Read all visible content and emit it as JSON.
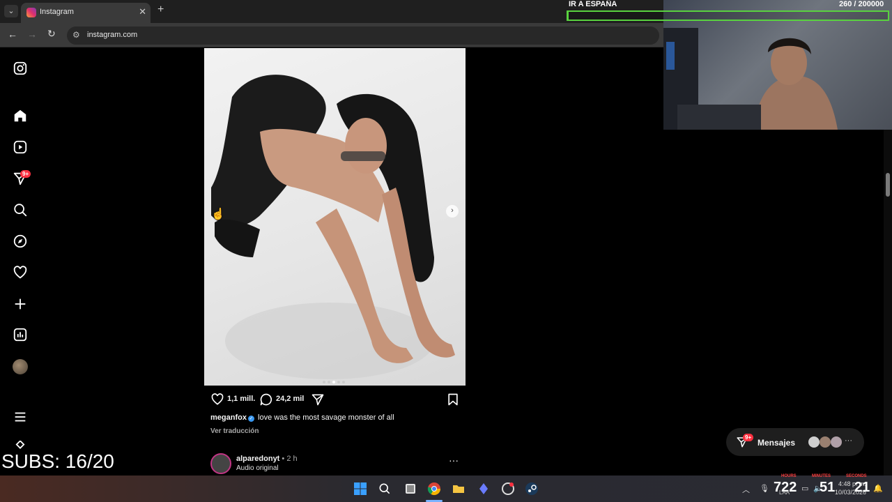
{
  "browser": {
    "tab_title": "Instagram",
    "url": "instagram.com",
    "tab_close": "✕",
    "tab_new": "+"
  },
  "sidebar": {
    "notifications_badge": "9+"
  },
  "post": {
    "likes": "1,1 mill.",
    "comments": "24,2 mil",
    "username": "meganfox",
    "caption": "love was the most savage monster of all",
    "translate": "Ver traducción",
    "carousel_dots": 5,
    "carousel_active": 2
  },
  "next_post": {
    "username": "alparedonyt",
    "time": "• 2 h",
    "subtitle": "Audio original",
    "more": "···"
  },
  "messages": {
    "label": "Mensajes",
    "badge": "9+"
  },
  "stream_overlay": {
    "goal_label": "IR A ESPAÑA",
    "goal_count": "260  / 200000",
    "goal_progress": 0.0013,
    "subs": "SUBS: 16/20",
    "countdown_hours": "722",
    "countdown_minutes": "51",
    "countdown_seconds": "21",
    "label_hours": "HOURS",
    "label_minutes": "MINUTES",
    "label_seconds": "SECONDS",
    "lang": "LAA"
  },
  "taskbar": {
    "time": "4:48 p. m.",
    "date": "10/03/2026"
  },
  "colors": {
    "accent": "#ff3040",
    "goal_green": "#59d23f",
    "verified": "#3897f0"
  }
}
